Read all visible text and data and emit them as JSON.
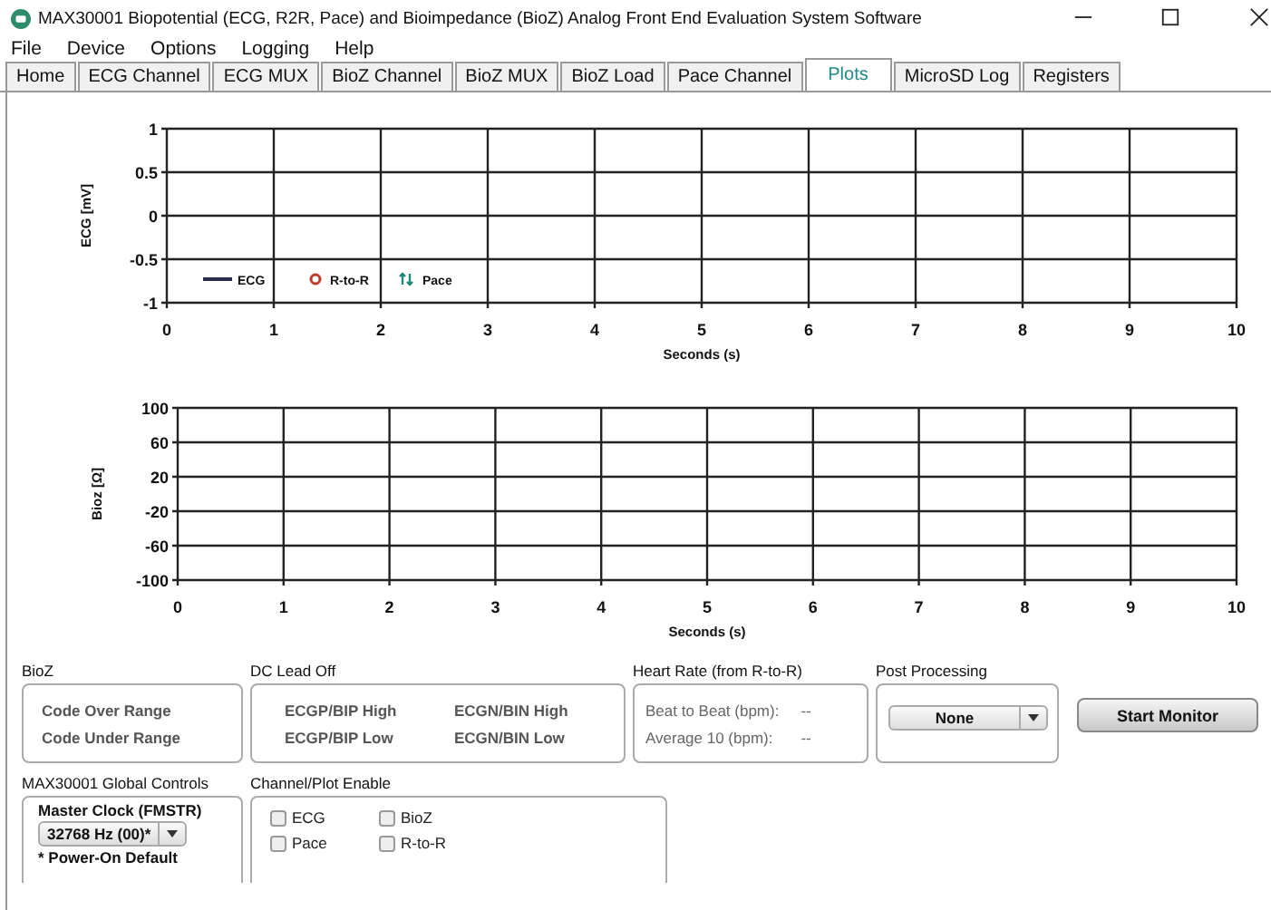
{
  "window": {
    "title": "MAX30001 Biopotential (ECG, R2R, Pace) and Bioimpedance (BioZ) Analog Front End Evaluation System Software"
  },
  "menu": [
    "File",
    "Device",
    "Options",
    "Logging",
    "Help"
  ],
  "tabs": [
    {
      "label": "Home",
      "selected": false
    },
    {
      "label": "ECG Channel",
      "selected": false
    },
    {
      "label": "ECG MUX",
      "selected": false
    },
    {
      "label": "BioZ Channel",
      "selected": false
    },
    {
      "label": "BioZ MUX",
      "selected": false
    },
    {
      "label": "BioZ Load",
      "selected": false
    },
    {
      "label": "Pace Channel",
      "selected": false
    },
    {
      "label": "Plots",
      "selected": true
    },
    {
      "label": "MicroSD Log",
      "selected": false
    },
    {
      "label": "Registers",
      "selected": false
    }
  ],
  "plots": [
    {
      "chart_data": {
        "type": "line",
        "xlabel": "Seconds (s)",
        "ylabel": "ECG [mV]",
        "categories": [
          "0",
          "1",
          "2",
          "3",
          "4",
          "5",
          "6",
          "7",
          "8",
          "9",
          "10"
        ],
        "ylim": [
          -1,
          1
        ],
        "yticks": [
          -1,
          -0.5,
          0,
          0.5,
          1
        ],
        "grid": true,
        "series": [
          {
            "name": "ECG",
            "color": "#2a2a4a",
            "values": [
              null,
              null,
              null,
              null,
              null,
              null,
              null,
              null,
              null,
              null,
              null
            ]
          },
          {
            "name": "R-to-R",
            "color": "#c0392b",
            "values": [
              null,
              null,
              null,
              null,
              null,
              null,
              null,
              null,
              null,
              null,
              null
            ]
          },
          {
            "name": "Pace",
            "color": "#1a8a7a",
            "values": [
              null,
              null,
              null,
              null,
              null,
              null,
              null,
              null,
              null,
              null,
              null
            ]
          }
        ]
      }
    },
    {
      "chart_data": {
        "type": "line",
        "xlabel": "Seconds (s)",
        "ylabel": "Bioz [Ω]",
        "categories": [
          "0",
          "1",
          "2",
          "3",
          "4",
          "5",
          "6",
          "7",
          "8",
          "9",
          "10"
        ],
        "ylim": [
          -100,
          100
        ],
        "yticks": [
          -100,
          -60,
          -20,
          20,
          60,
          100
        ],
        "grid": true
      }
    }
  ],
  "bioz": {
    "title": "BioZ",
    "items": [
      "Code Over Range",
      "Code Under Range"
    ]
  },
  "dc_lead_off": {
    "title": "DC Lead Off",
    "items": [
      "ECGP/BIP High",
      "ECGN/BIN High",
      "ECGP/BIP Low",
      "ECGN/BIN Low"
    ]
  },
  "heart_rate": {
    "title": "Heart Rate (from R-to-R)",
    "rows": [
      {
        "label": "Beat to Beat (bpm):",
        "value": "--"
      },
      {
        "label": "Average 10 (bpm):",
        "value": "--"
      }
    ]
  },
  "post_processing": {
    "title": "Post Processing",
    "value": "None"
  },
  "start_button": "Start Monitor",
  "global_controls": {
    "title": "MAX30001 Global Controls",
    "label": "Master Clock (FMSTR)",
    "value": "32768 Hz (00)*",
    "note": "* Power-On Default"
  },
  "channel_enable": {
    "title": "Channel/Plot Enable",
    "items": [
      {
        "label": "ECG",
        "checked": false
      },
      {
        "label": "BioZ",
        "checked": false
      },
      {
        "label": "Pace",
        "checked": false
      },
      {
        "label": "R-to-R",
        "checked": false
      }
    ]
  }
}
